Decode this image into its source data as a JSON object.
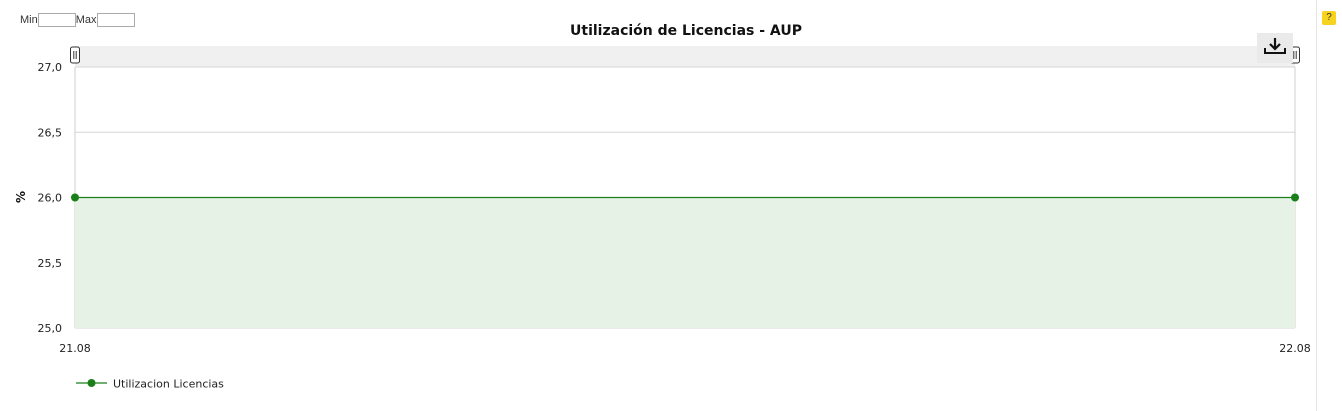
{
  "range": {
    "min_label": "Min",
    "max_label": "Max",
    "min_value": "",
    "max_value": ""
  },
  "help": {
    "label": "?"
  },
  "colors": {
    "series": "#1a7f1a",
    "area": "#e6f2e6",
    "grid": "#d6d6d6",
    "navigator": "#f0f0f0",
    "help": "#f7d21e"
  },
  "icons": {
    "download": "download-icon"
  },
  "chart_data": {
    "type": "area",
    "title": "Utilización de Licencias - AUP",
    "xlabel": "",
    "ylabel": "%",
    "x": [
      "21.08",
      "22.08"
    ],
    "series": [
      {
        "name": "Utilizacion Licencias",
        "values": [
          26.0,
          26.0
        ]
      }
    ],
    "ylim": [
      25.0,
      27.0
    ],
    "yticks": [
      "25,0",
      "25,5",
      "26,0",
      "26,5",
      "27,0"
    ],
    "ytick_values": [
      25.0,
      25.5,
      26.0,
      26.5,
      27.0
    ],
    "grid": true,
    "legend": "bottom-left"
  }
}
